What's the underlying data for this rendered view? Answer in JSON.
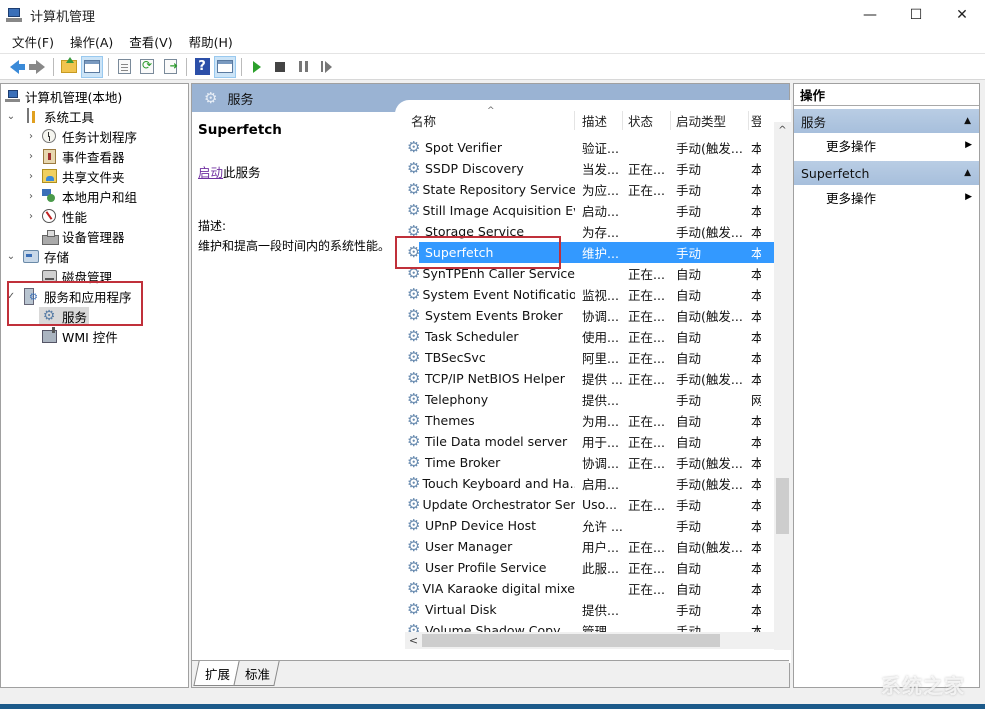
{
  "window": {
    "title": "计算机管理",
    "controls": {
      "minimize": "—",
      "maximize": "☐",
      "close": "✕"
    }
  },
  "menu": [
    "文件(F)",
    "操作(A)",
    "查看(V)",
    "帮助(H)"
  ],
  "toolbar": {
    "buttons": [
      "back",
      "forward",
      "up-folder",
      "show-hide-console-tree",
      "properties",
      "refresh",
      "export-list",
      "help",
      "show-hide-action-pane",
      "start-service",
      "stop-service",
      "pause-service",
      "resume-service"
    ]
  },
  "tree": {
    "root": "计算机管理(本地)",
    "items": [
      {
        "label": "系统工具",
        "expander": "⌄"
      },
      {
        "label": "任务计划程序",
        "expander": "›"
      },
      {
        "label": "事件查看器",
        "expander": "›"
      },
      {
        "label": "共享文件夹",
        "expander": "›"
      },
      {
        "label": "本地用户和组",
        "expander": "›"
      },
      {
        "label": "性能",
        "expander": "›"
      },
      {
        "label": "设备管理器",
        "expander": ""
      },
      {
        "label": "存储",
        "expander": "⌄"
      },
      {
        "label": "磁盘管理",
        "expander": ""
      },
      {
        "label": "服务和应用程序",
        "expander": "✓"
      },
      {
        "label": "服务",
        "expander": ""
      },
      {
        "label": "WMI 控件",
        "expander": ""
      }
    ]
  },
  "center": {
    "header": "服务",
    "extended": {
      "service_name": "Superfetch",
      "link": "启动",
      "link_suffix": "此服务",
      "desc_label": "描述:",
      "desc": "维护和提高一段时间内的系统性能。"
    },
    "columns": {
      "name": "名称",
      "desc": "描述",
      "status": "状态",
      "startup": "启动类型",
      "logon": "登"
    },
    "rows": [
      {
        "name": "Spot Verifier",
        "desc": "验证...",
        "status": "",
        "startup": "手动(触发...",
        "logon": "本"
      },
      {
        "name": "SSDP Discovery",
        "desc": "当发...",
        "status": "正在...",
        "startup": "手动",
        "logon": "本"
      },
      {
        "name": "State Repository Service",
        "desc": "为应...",
        "status": "正在...",
        "startup": "手动",
        "logon": "本"
      },
      {
        "name": "Still Image Acquisition Ev...",
        "desc": "启动...",
        "status": "",
        "startup": "手动",
        "logon": "本"
      },
      {
        "name": "Storage Service",
        "desc": "为存...",
        "status": "",
        "startup": "手动(触发...",
        "logon": "本"
      },
      {
        "name": "Superfetch",
        "desc": "维护...",
        "status": "",
        "startup": "手动",
        "logon": "本",
        "selected": true
      },
      {
        "name": "SynTPEnh Caller Service",
        "desc": "",
        "status": "正在...",
        "startup": "自动",
        "logon": "本"
      },
      {
        "name": "System Event Notification...",
        "desc": "监视...",
        "status": "正在...",
        "startup": "自动",
        "logon": "本"
      },
      {
        "name": "System Events Broker",
        "desc": "协调...",
        "status": "正在...",
        "startup": "自动(触发...",
        "logon": "本"
      },
      {
        "name": "Task Scheduler",
        "desc": "使用...",
        "status": "正在...",
        "startup": "自动",
        "logon": "本"
      },
      {
        "name": "TBSecSvc",
        "desc": "阿里...",
        "status": "正在...",
        "startup": "自动",
        "logon": "本"
      },
      {
        "name": "TCP/IP NetBIOS Helper",
        "desc": "提供 ...",
        "status": "正在...",
        "startup": "手动(触发...",
        "logon": "本"
      },
      {
        "name": "Telephony",
        "desc": "提供...",
        "status": "",
        "startup": "手动",
        "logon": "网"
      },
      {
        "name": "Themes",
        "desc": "为用...",
        "status": "正在...",
        "startup": "自动",
        "logon": "本"
      },
      {
        "name": "Tile Data model server",
        "desc": "用于...",
        "status": "正在...",
        "startup": "自动",
        "logon": "本"
      },
      {
        "name": "Time Broker",
        "desc": "协调...",
        "status": "正在...",
        "startup": "手动(触发...",
        "logon": "本"
      },
      {
        "name": "Touch Keyboard and Ha...",
        "desc": "启用...",
        "status": "",
        "startup": "手动(触发...",
        "logon": "本"
      },
      {
        "name": "Update Orchestrator Ser...",
        "desc": "Uso...",
        "status": "正在...",
        "startup": "手动",
        "logon": "本"
      },
      {
        "name": "UPnP Device Host",
        "desc": "允许 ...",
        "status": "",
        "startup": "手动",
        "logon": "本"
      },
      {
        "name": "User Manager",
        "desc": "用户...",
        "status": "正在...",
        "startup": "自动(触发...",
        "logon": "本"
      },
      {
        "name": "User Profile Service",
        "desc": "此服...",
        "status": "正在...",
        "startup": "自动",
        "logon": "本"
      },
      {
        "name": "VIA Karaoke digital mixe...",
        "desc": "",
        "status": "正在...",
        "startup": "自动",
        "logon": "本"
      },
      {
        "name": "Virtual Disk",
        "desc": "提供...",
        "status": "",
        "startup": "手动",
        "logon": "本"
      },
      {
        "name": "Volume Shadow Copy",
        "desc": "管理...",
        "status": "",
        "startup": "手动",
        "logon": "本"
      }
    ],
    "tabs": [
      "扩展",
      "标准"
    ]
  },
  "actions": {
    "title": "操作",
    "sections": [
      {
        "label": "服务",
        "item": "更多操作"
      },
      {
        "label": "Superfetch",
        "item": "更多操作"
      }
    ]
  },
  "watermark": "系统之家",
  "colors": {
    "selection": "#3399ff",
    "header": "#9ab3d3",
    "highlight_box": "#c0303a",
    "link": "#7030a0"
  }
}
